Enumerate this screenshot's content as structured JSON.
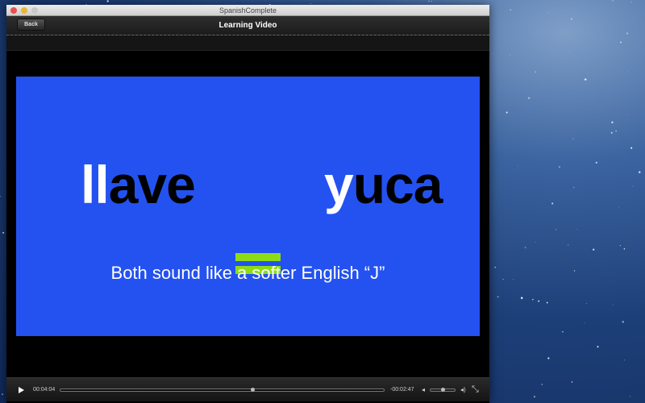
{
  "window": {
    "title": "SpanishComplete"
  },
  "toolbar": {
    "back_label": "Back",
    "title": "Learning Video"
  },
  "slide": {
    "word1_highlight": "ll",
    "word1_rest": "ave",
    "equals": "=",
    "word2_highlight": "y",
    "word2_rest": "uca",
    "subtitle": "Both sound like a softer English “J”",
    "background": "#2452f0",
    "equals_color": "#8edc16"
  },
  "player": {
    "elapsed": "00:04:04",
    "remaining": "-00:02:47",
    "progress": 0.594,
    "volume": 0.5,
    "play_icon": "play-icon",
    "fullscreen_icon": "fullscreen-icon"
  }
}
